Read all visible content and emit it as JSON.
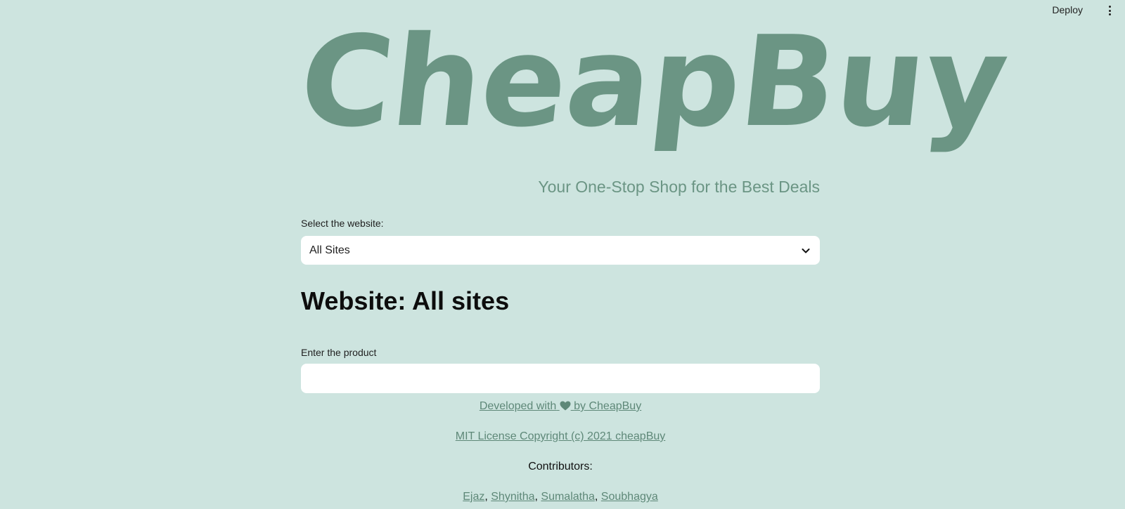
{
  "topbar": {
    "deploy_label": "Deploy",
    "menu_icon": "kebab-menu-icon"
  },
  "logo": {
    "text": "CheapBuy"
  },
  "tagline": "Your One-Stop Shop for the Best Deals",
  "website_select": {
    "label": "Select the website:",
    "value": "All Sites"
  },
  "heading": "Website: All sites",
  "product_input": {
    "label": "Enter the product",
    "value": "",
    "placeholder": ""
  },
  "footer": {
    "developed_prefix": "Developed with",
    "developed_suffix": "by CheapBuy",
    "heart_icon": "heart-icon",
    "license": "MIT License Copyright (c) 2021 cheapBuy",
    "contributors_label": "Contributors:",
    "contributors": [
      "Ejaz",
      "Shynitha",
      "Sumalatha",
      "Soubhagya"
    ]
  },
  "colors": {
    "background": "#cde4df",
    "accent": "#6b9584",
    "link": "#5e8878"
  }
}
